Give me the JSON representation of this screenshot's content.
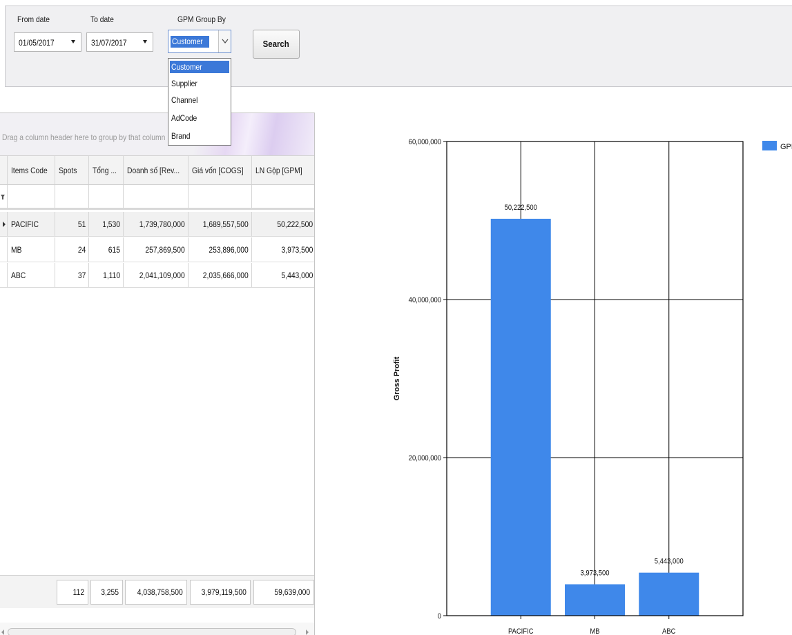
{
  "filters": {
    "from_date_label": "From date",
    "from_date_value": "01/05/2017",
    "to_date_label": "To date",
    "to_date_value": "31/07/2017",
    "group_by_label": "GPM Group By",
    "group_by_value": "Customer",
    "group_by_options": [
      "Customer",
      "Supplier",
      "Channel",
      "AdCode",
      "Brand"
    ],
    "search_label": "Search"
  },
  "grid": {
    "group_panel_hint": "Drag a column header here to group by that column",
    "columns": [
      "Items Code",
      "Spots",
      "Tổng ...",
      "Doanh số [Rev...",
      "Giá vốn [COGS]",
      "LN Gộp [GPM]"
    ],
    "rows": [
      [
        "PACIFIC",
        "51",
        "1,530",
        "1,739,780,000",
        "1,689,557,500",
        "50,222,500"
      ],
      [
        "MB",
        "24",
        "615",
        "257,869,500",
        "253,896,000",
        "3,973,500"
      ],
      [
        "ABC",
        "37",
        "1,110",
        "2,041,109,000",
        "2,035,666,000",
        "5,443,000"
      ]
    ],
    "totals": [
      "112",
      "3,255",
      "4,038,758,500",
      "3,979,119,500",
      "59,639,000"
    ]
  },
  "chart_data": {
    "type": "bar",
    "categories": [
      "PACIFIC",
      "MB",
      "ABC"
    ],
    "series": [
      {
        "name": "GPM",
        "values": [
          50222500,
          3973500,
          5443000
        ]
      }
    ],
    "data_labels": [
      "50,222,500",
      "3,973,500",
      "5,443,000"
    ],
    "ylabel": "Gross Profit",
    "xlabel": "",
    "ylim": [
      0,
      60000000
    ],
    "yticks": [
      0,
      20000000,
      40000000,
      60000000
    ],
    "ytick_labels": [
      "0",
      "20,000,000",
      "40,000,000",
      "60,000,000"
    ],
    "legend_position": "top-right",
    "grid": true,
    "bar_color": "#3f88ea"
  }
}
